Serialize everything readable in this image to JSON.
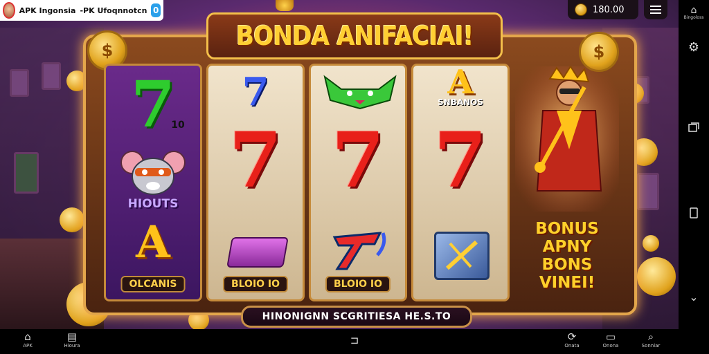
{
  "header": {
    "app_title": "APK Ingonsia  ‐PK Ufoqnnotcn",
    "app_badge": "0",
    "balance": "180.00"
  },
  "game": {
    "title": "BONDA ANIFACIAI!",
    "coin_symbol": "$",
    "reels": [
      {
        "top": "7",
        "top_suffix": "10",
        "middle_label": "HIOUTS",
        "bottom_symbol": "A",
        "bottom_label": "OLCANIS"
      },
      {
        "top": "7",
        "middle": "7",
        "bottom_label": "BLOIO IO"
      },
      {
        "middle": "7",
        "bottom_label": "BLOIO IO"
      },
      {
        "top_symbol": "A",
        "top_label": "SNBANOS",
        "middle": "7"
      }
    ],
    "bonus_lines": [
      "BONUS",
      "APNY",
      "BONS VINEI!"
    ],
    "bottom_banner": "HINONIGNN SCGRITIESA HE.S.TO"
  },
  "sidebar": {
    "items": [
      {
        "icon": "home-icon",
        "label": "Bingoloss"
      },
      {
        "icon": "gear-icon",
        "label": ""
      },
      {
        "icon": "windows-icon",
        "label": ""
      },
      {
        "icon": "square-icon",
        "label": ""
      },
      {
        "icon": "chevron-down-icon",
        "label": ""
      },
      {
        "icon": "tablet-icon",
        "label": ""
      }
    ]
  },
  "navbar": {
    "items": [
      {
        "icon": "home-icon",
        "label": "APK"
      },
      {
        "icon": "bag-icon",
        "label": "Hioura"
      },
      {
        "icon": "back-icon",
        "label": ""
      },
      {
        "icon": "refresh-icon",
        "label": "Onata"
      },
      {
        "icon": "box-icon",
        "label": "Onona"
      },
      {
        "icon": "search-icon",
        "label": "Sonniar"
      }
    ]
  },
  "colors": {
    "accent_gold": "#ffcf33",
    "seven_red": "#e8201a",
    "seven_green": "#2ecc2e",
    "seven_blue": "#3a5aee",
    "frame_brown": "#8b4a1e"
  }
}
